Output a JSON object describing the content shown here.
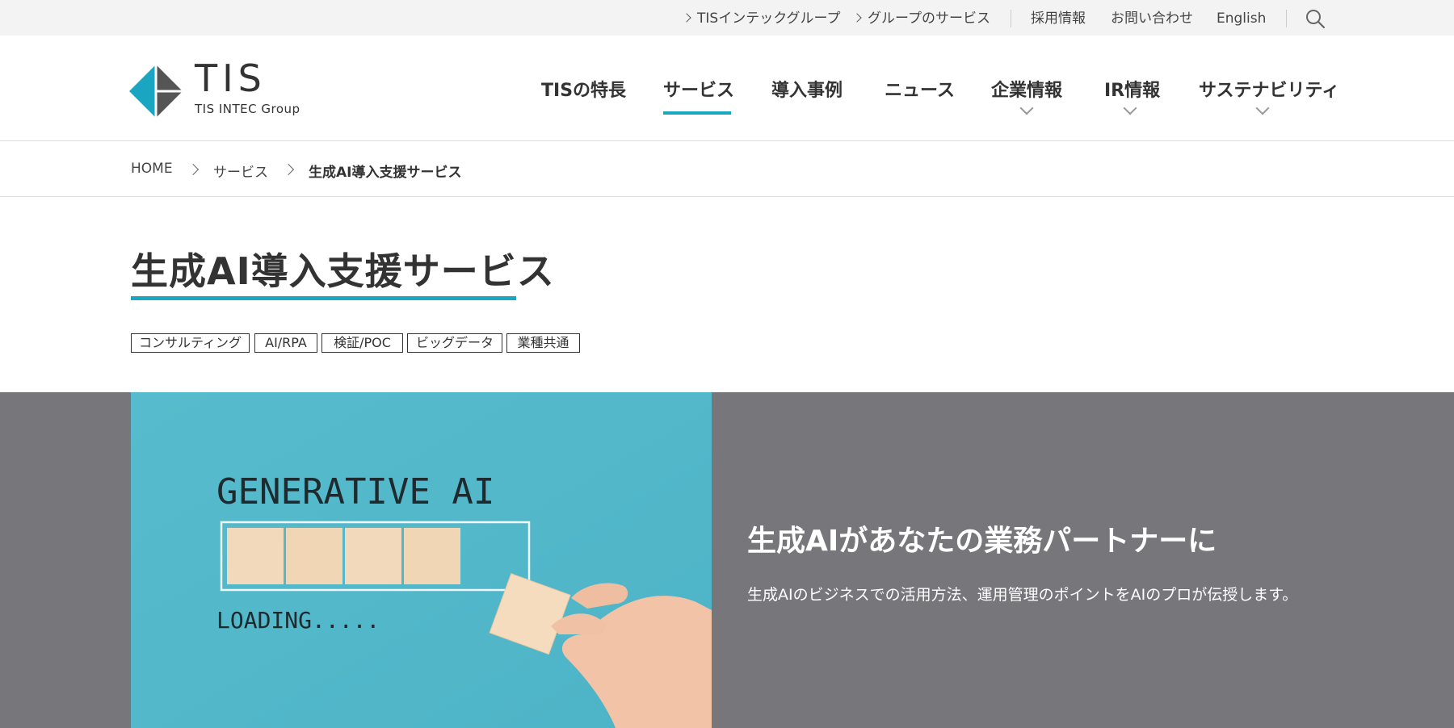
{
  "utility_nav": {
    "group_link": "TISインテックグループ",
    "group_services_link": "グループのサービス",
    "recruit_link": "採用情報",
    "contact_link": "お問い合わせ",
    "english_link": "English",
    "search_icon": "search-icon"
  },
  "logo": {
    "wordmark": "TIS",
    "subtitle": "TIS INTEC Group",
    "colors": {
      "teal": "#1aa5c0",
      "dark": "#555555"
    }
  },
  "global_nav": {
    "items": [
      {
        "label": "TISの特長",
        "active": false,
        "has_dropdown": false
      },
      {
        "label": "サービス",
        "active": true,
        "has_dropdown": false
      },
      {
        "label": "導入事例",
        "active": false,
        "has_dropdown": false
      },
      {
        "label": "ニュース",
        "active": false,
        "has_dropdown": false
      },
      {
        "label": "企業情報",
        "active": false,
        "has_dropdown": true
      },
      {
        "label": "IR情報",
        "active": false,
        "has_dropdown": true
      },
      {
        "label": "サステナビリティ",
        "active": false,
        "has_dropdown": true
      }
    ],
    "accent_color": "#1aa5c0"
  },
  "breadcrumb": {
    "items": [
      "HOME",
      "サービス",
      "生成AI導入支援サービス"
    ]
  },
  "page": {
    "title": "生成AI導入支援サービス",
    "tags": [
      "コンサルティング",
      "AI/RPA",
      "検証/POC",
      "ビッグデータ",
      "業種共通"
    ]
  },
  "hero": {
    "image_text_top": "GENERATIVE AI",
    "image_text_bottom": "LOADING.....",
    "loading_blocks_filled": 4,
    "headline": "生成AIがあなたの業務パートナーに",
    "description": "生成AIのビジネスでの活用方法、運用管理のポイントをAIのプロが伝授します。",
    "background_color": "#77767b",
    "image_background": "#5cbfcf"
  }
}
